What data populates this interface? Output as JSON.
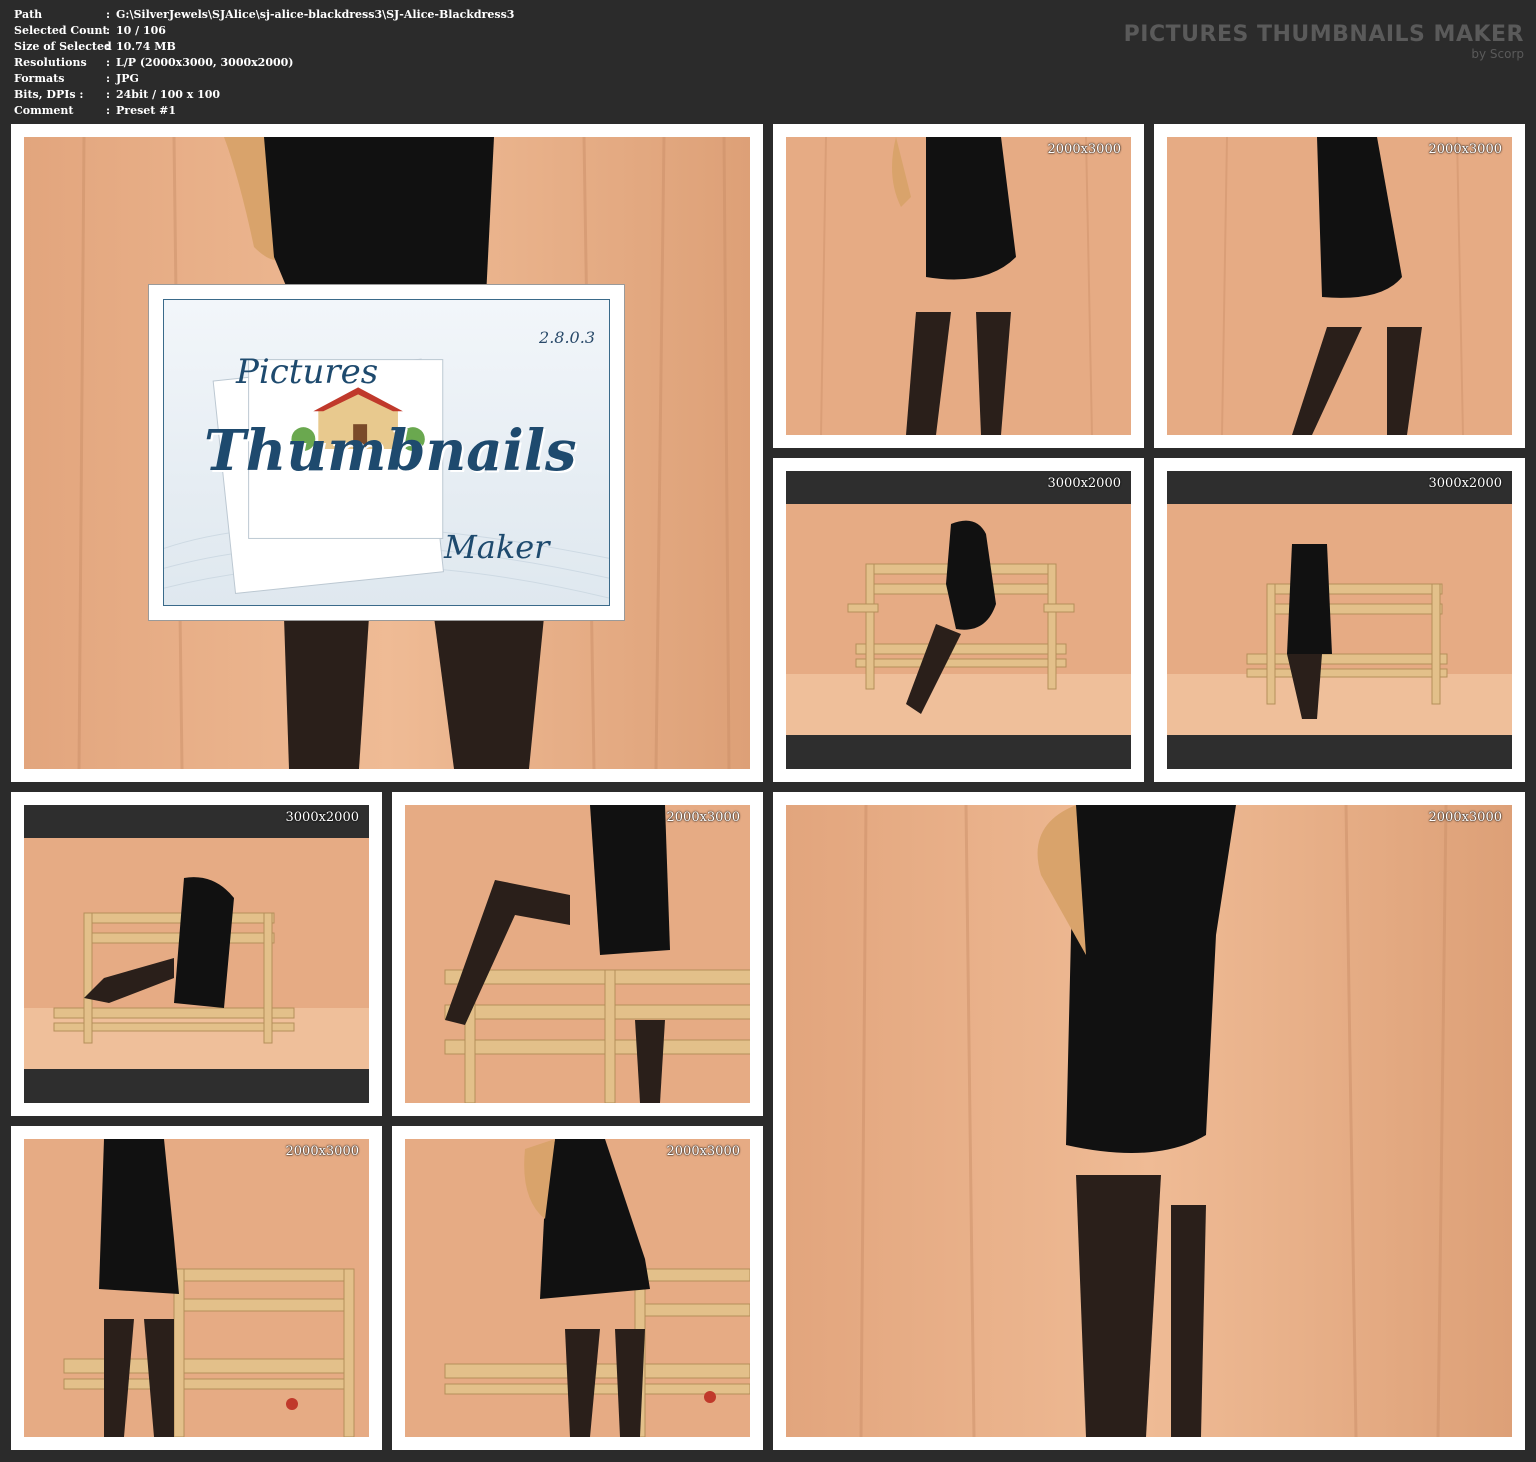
{
  "info": [
    {
      "key": "Path",
      "value": "G:\\SilverJewels\\SJAlice\\sj-alice-blackdress3\\SJ-Alice-Blackdress3"
    },
    {
      "key": "Selected Count",
      "value": "10 / 106"
    },
    {
      "key": "Size of Selected",
      "value": "10.74 MB"
    },
    {
      "key": "Resolutions",
      "value": "L/P (2000x3000, 3000x2000)"
    },
    {
      "key": "Formats",
      "value": "JPG"
    },
    {
      "key": "Bits, DPIs :",
      "value": "24bit / 100 x 100"
    },
    {
      "key": "Comment",
      "value": "Preset #1"
    }
  ],
  "separator": ":",
  "brand": {
    "title": "PICTURES THUMBNAILS MAKER",
    "subtitle": "by Scorp"
  },
  "logo": {
    "version": "2.8.0.3",
    "word1": "Pictures",
    "word2": "Thumbnails",
    "word3": "Maker"
  },
  "tiles": [
    {
      "id": "t1",
      "resolution": ""
    },
    {
      "id": "t2",
      "resolution": "2000x3000"
    },
    {
      "id": "t3",
      "resolution": "2000x3000"
    },
    {
      "id": "t4",
      "resolution": "3000x2000"
    },
    {
      "id": "t5",
      "resolution": "3000x2000"
    },
    {
      "id": "t6",
      "resolution": "3000x2000"
    },
    {
      "id": "t7",
      "resolution": "2000x3000"
    },
    {
      "id": "t8",
      "resolution": "2000x3000"
    },
    {
      "id": "t9",
      "resolution": "2000x3000"
    },
    {
      "id": "t10",
      "resolution": "2000x3000"
    }
  ],
  "colors": {
    "background": "#2b2b2b",
    "frame": "#ffffff",
    "backdrop": "#e8b088",
    "dark_band": "#2e2e2e"
  }
}
